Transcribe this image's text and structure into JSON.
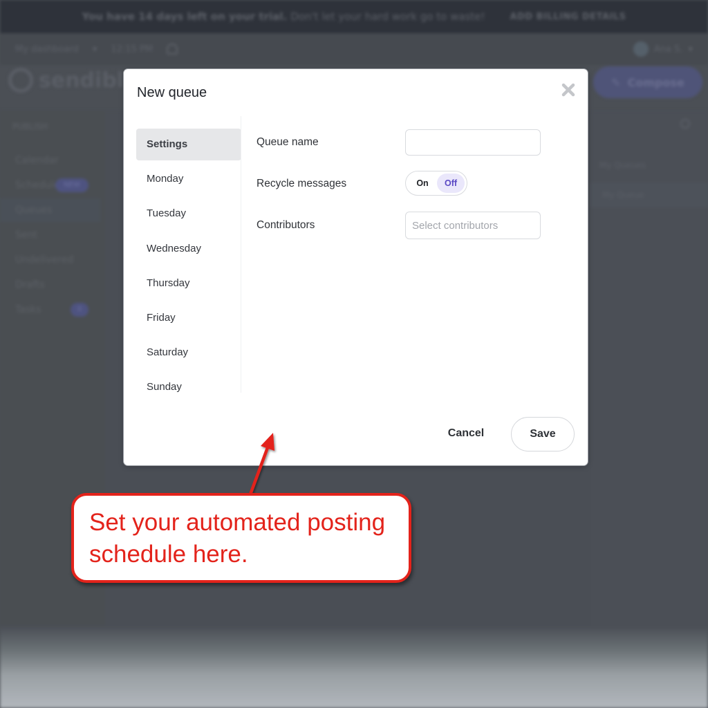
{
  "background": {
    "trial_banner": {
      "message_bold": "You have 14 days left on your trial.",
      "message": "Don't let your hard work go to waste!",
      "action": "ADD BILLING DETAILS"
    },
    "topbar": {
      "dashboard_selector": "My dashboard",
      "time": "12:15 PM",
      "user_name": "Ana S."
    },
    "logo_text": "sendible",
    "compose_label": "Compose",
    "sidebar": {
      "heading": "PUBLISH",
      "items": [
        {
          "label": "Calendar"
        },
        {
          "label": "Schedule",
          "badge": "NEW"
        },
        {
          "label": "Queues",
          "active": true
        },
        {
          "label": "Sent"
        },
        {
          "label": "Undelivered"
        },
        {
          "label": "Drafts"
        },
        {
          "label": "Tasks",
          "badge": "0"
        }
      ]
    },
    "right_panel": {
      "heading": "My Queues",
      "row": "My Queue"
    }
  },
  "modal": {
    "title": "New queue",
    "tabs": [
      {
        "label": "Settings",
        "active": true
      },
      {
        "label": "Monday"
      },
      {
        "label": "Tuesday"
      },
      {
        "label": "Wednesday"
      },
      {
        "label": "Thursday"
      },
      {
        "label": "Friday"
      },
      {
        "label": "Saturday"
      },
      {
        "label": "Sunday"
      }
    ],
    "fields": {
      "queue_name": {
        "label": "Queue name",
        "value": "",
        "placeholder": ""
      },
      "recycle": {
        "label": "Recycle messages",
        "on_label": "On",
        "off_label": "Off",
        "selected": "Off"
      },
      "contributors": {
        "label": "Contributors",
        "value": "",
        "placeholder": "Select contributors"
      }
    },
    "cancel_label": "Cancel",
    "save_label": "Save"
  },
  "annotation": {
    "text": "Set your automated posting schedule here.",
    "color": "#e3231b"
  },
  "colors": {
    "accent": "#5a48c4",
    "toggle_selected_bg": "#eae7fb"
  }
}
